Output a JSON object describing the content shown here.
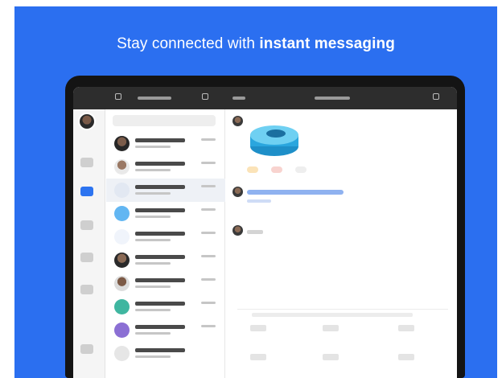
{
  "banner": {
    "headline_plain": "Stay connected with ",
    "headline_bold": "instant messaging",
    "background_color": "#2b6ff0"
  },
  "app": {
    "top_bar_icons": [
      "back-icon",
      "compose-icon",
      "info-icon"
    ],
    "rail_tabs": [
      "home-tab-icon",
      "chat-tab-icon",
      "meetings-tab-icon",
      "contacts-tab-icon",
      "settings-tab-icon",
      "more-tab-icon"
    ],
    "selected_conversation_index": 3,
    "conversations_count_visible": 10,
    "accent_color": "#2d74f0"
  }
}
